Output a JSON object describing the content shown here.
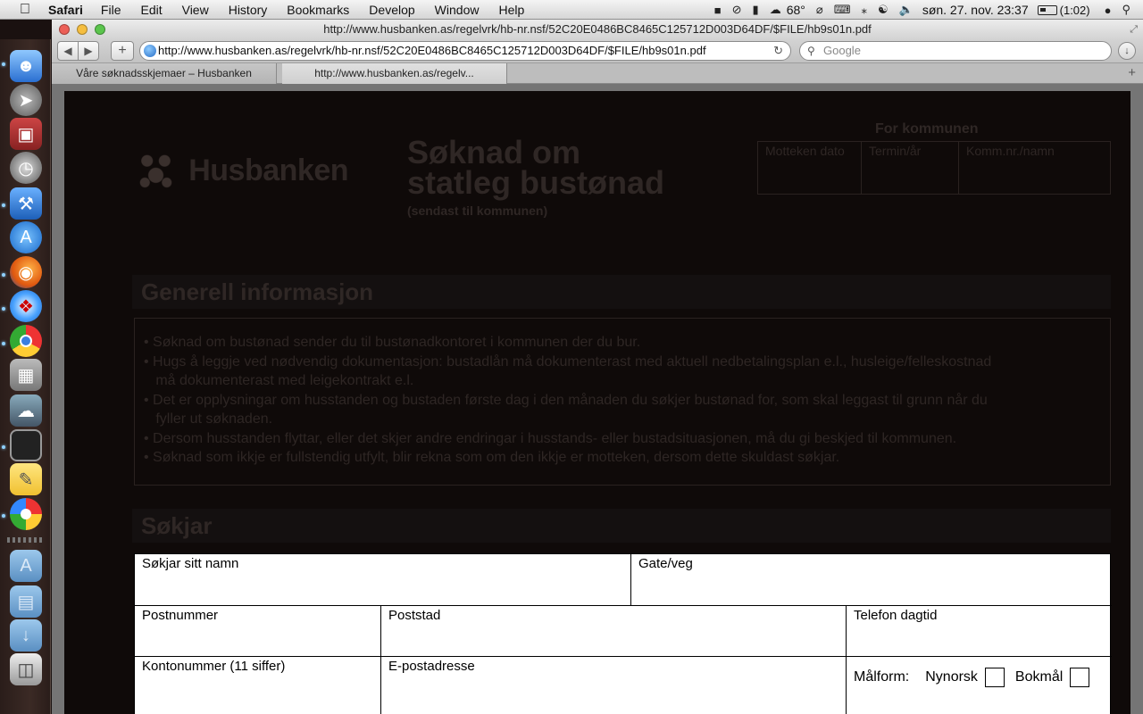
{
  "menubar": {
    "app": "Safari",
    "items": [
      "File",
      "Edit",
      "View",
      "History",
      "Bookmarks",
      "Develop",
      "Window",
      "Help"
    ],
    "temperature": "68°",
    "datetime": "søn. 27. nov.  23:37",
    "battery": "(1:02)"
  },
  "window": {
    "title": "http://www.husbanken.as/regelvrk/hb-nr.nsf/52C20E0486BC8465C125712D003D64DF/$FILE/hb9s01n.pdf",
    "url": "http://www.husbanken.as/regelvrk/hb-nr.nsf/52C20E0486BC8465C125712D003D64DF/$FILE/hb9s01n.pdf",
    "search_placeholder": "Google",
    "tabs": [
      {
        "label": "Våre søknadsskjemaer – Husbanken"
      },
      {
        "label": "http://www.husbanken.as/regelv..."
      }
    ]
  },
  "dock": {
    "icons": [
      "finder-icon",
      "rocket-icon",
      "photo-booth-icon",
      "time-machine-icon",
      "xcode-icon",
      "app-store-icon",
      "firefox-icon",
      "safari-icon",
      "chrome-icon",
      "calculator-icon",
      "preview-icon",
      "terminal-icon",
      "stickies-icon",
      "picasa-icon",
      "applications-folder-icon",
      "documents-folder-icon",
      "downloads-folder-icon",
      "trash-icon"
    ]
  },
  "document": {
    "logo_text": "Husbanken",
    "title_line1": "Søknad om",
    "title_line2": "statleg bustønad",
    "subtitle": "(sendast til kommunen)",
    "municipality_heading": "For kommunen",
    "municipality_fields": [
      "Motteken dato",
      "Termin/år",
      "Komm.nr./namn"
    ],
    "section1_heading": "Generell informasjon",
    "info_lines": [
      "• Søknad om bustønad sender du til bustønadkontoret i kommunen der du bur.",
      "• Hugs å leggje ved nødvendig dokumentasjon: bustadlån må dokumenterast med aktuell nedbetalingsplan e.l., husleige/felleskostnad",
      "   må dokumenterast med leigekontrakt e.l.",
      "• Det er opplysningar om husstanden og bustaden første dag i den månaden du søkjer bustønad for, som skal leggast til grunn når du",
      "   fyller ut søknaden.",
      "• Dersom husstanden flyttar, eller det skjer andre endringar i husstands- eller bustadsituasjonen, må du gi beskjed til kommunen.",
      "• Søknad som ikkje er fullstendig utfylt, blir rekna som om den ikkje er motteken, dersom dette skuldast søkjar."
    ],
    "section2_heading": "Søkjar",
    "fields": {
      "name": "Søkjar sitt namn",
      "street": "Gate/veg",
      "postcode": "Postnummer",
      "postplace": "Poststad",
      "phone": "Telefon dagtid",
      "account": "Kontonummer (11 siffer)",
      "email": "E-postadresse",
      "language_label": "Målform:",
      "nynorsk": "Nynorsk",
      "bokmal": "Bokmål"
    }
  }
}
